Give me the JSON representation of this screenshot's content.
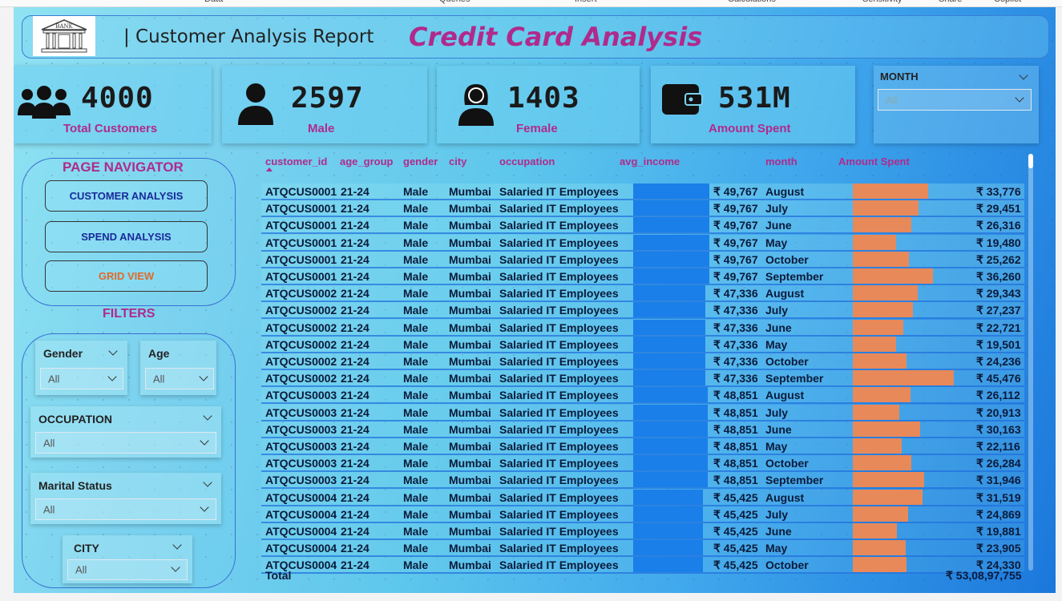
{
  "ribbon": [
    "Data",
    "Queries",
    "Insert",
    "Calculations",
    "Sensitivity",
    "Share",
    "Copilot"
  ],
  "header": {
    "logo_text": "BANK",
    "report_title": "| Customer Analysis Report",
    "main_title": "Credit Card Analysis"
  },
  "kpis": [
    {
      "value": "4000",
      "label": "Total Customers",
      "icon": "users-group-icon"
    },
    {
      "value": "2597",
      "label": "Male",
      "icon": "male-user-icon"
    },
    {
      "value": "1403",
      "label": "Female",
      "icon": "female-user-icon"
    },
    {
      "value": "531M",
      "label": "Amount Spent",
      "icon": "wallet-icon"
    }
  ],
  "month_slicer": {
    "title": "MONTH",
    "value": "All"
  },
  "navigator": {
    "title": "PAGE NAVIGATOR",
    "buttons": [
      {
        "label": "CUSTOMER ANALYSIS",
        "color": "#1a2a9a"
      },
      {
        "label": "SPEND ANALYSIS",
        "color": "#1a2a9a"
      },
      {
        "label": "GRID VIEW",
        "color": "#e06a2a"
      }
    ]
  },
  "filters": {
    "title": "FILTERS",
    "gender": {
      "title": "Gender",
      "value": "All"
    },
    "age": {
      "title": "Age",
      "value": "All"
    },
    "occupation": {
      "title": "OCCUPATION",
      "value": "All"
    },
    "marital": {
      "title": "Marital Status",
      "value": "All"
    },
    "city": {
      "title": "CITY",
      "value": "All"
    }
  },
  "table": {
    "columns": [
      "customer_id",
      "age_group",
      "gender",
      "city",
      "occupation",
      "avg_income",
      "month",
      "Amount Spent"
    ],
    "income_bar_color": "#1a7fe8",
    "spend_bar_color": "#e8895a",
    "rows": [
      {
        "id": "ATQCUS0001",
        "age": "21-24",
        "gender": "Male",
        "city": "Mumbai",
        "occ": "Salaried IT Employees",
        "inc": "₹ 49,767",
        "inc_v": 49767,
        "month": "August",
        "amt": "₹ 33,776",
        "amt_v": 33776
      },
      {
        "id": "ATQCUS0001",
        "age": "21-24",
        "gender": "Male",
        "city": "Mumbai",
        "occ": "Salaried IT Employees",
        "inc": "₹ 49,767",
        "inc_v": 49767,
        "month": "July",
        "amt": "₹ 29,451",
        "amt_v": 29451
      },
      {
        "id": "ATQCUS0001",
        "age": "21-24",
        "gender": "Male",
        "city": "Mumbai",
        "occ": "Salaried IT Employees",
        "inc": "₹ 49,767",
        "inc_v": 49767,
        "month": "June",
        "amt": "₹ 26,316",
        "amt_v": 26316
      },
      {
        "id": "ATQCUS0001",
        "age": "21-24",
        "gender": "Male",
        "city": "Mumbai",
        "occ": "Salaried IT Employees",
        "inc": "₹ 49,767",
        "inc_v": 49767,
        "month": "May",
        "amt": "₹ 19,480",
        "amt_v": 19480
      },
      {
        "id": "ATQCUS0001",
        "age": "21-24",
        "gender": "Male",
        "city": "Mumbai",
        "occ": "Salaried IT Employees",
        "inc": "₹ 49,767",
        "inc_v": 49767,
        "month": "October",
        "amt": "₹ 25,262",
        "amt_v": 25262
      },
      {
        "id": "ATQCUS0001",
        "age": "21-24",
        "gender": "Male",
        "city": "Mumbai",
        "occ": "Salaried IT Employees",
        "inc": "₹ 49,767",
        "inc_v": 49767,
        "month": "September",
        "amt": "₹ 36,260",
        "amt_v": 36260
      },
      {
        "id": "ATQCUS0002",
        "age": "21-24",
        "gender": "Male",
        "city": "Mumbai",
        "occ": "Salaried IT Employees",
        "inc": "₹ 47,336",
        "inc_v": 47336,
        "month": "August",
        "amt": "₹ 29,343",
        "amt_v": 29343
      },
      {
        "id": "ATQCUS0002",
        "age": "21-24",
        "gender": "Male",
        "city": "Mumbai",
        "occ": "Salaried IT Employees",
        "inc": "₹ 47,336",
        "inc_v": 47336,
        "month": "July",
        "amt": "₹ 27,237",
        "amt_v": 27237
      },
      {
        "id": "ATQCUS0002",
        "age": "21-24",
        "gender": "Male",
        "city": "Mumbai",
        "occ": "Salaried IT Employees",
        "inc": "₹ 47,336",
        "inc_v": 47336,
        "month": "June",
        "amt": "₹ 22,721",
        "amt_v": 22721
      },
      {
        "id": "ATQCUS0002",
        "age": "21-24",
        "gender": "Male",
        "city": "Mumbai",
        "occ": "Salaried IT Employees",
        "inc": "₹ 47,336",
        "inc_v": 47336,
        "month": "May",
        "amt": "₹ 19,501",
        "amt_v": 19501
      },
      {
        "id": "ATQCUS0002",
        "age": "21-24",
        "gender": "Male",
        "city": "Mumbai",
        "occ": "Salaried IT Employees",
        "inc": "₹ 47,336",
        "inc_v": 47336,
        "month": "October",
        "amt": "₹ 24,236",
        "amt_v": 24236
      },
      {
        "id": "ATQCUS0002",
        "age": "21-24",
        "gender": "Male",
        "city": "Mumbai",
        "occ": "Salaried IT Employees",
        "inc": "₹ 47,336",
        "inc_v": 47336,
        "month": "September",
        "amt": "₹ 45,476",
        "amt_v": 45476
      },
      {
        "id": "ATQCUS0003",
        "age": "21-24",
        "gender": "Male",
        "city": "Mumbai",
        "occ": "Salaried IT Employees",
        "inc": "₹ 48,851",
        "inc_v": 48851,
        "month": "August",
        "amt": "₹ 26,112",
        "amt_v": 26112
      },
      {
        "id": "ATQCUS0003",
        "age": "21-24",
        "gender": "Male",
        "city": "Mumbai",
        "occ": "Salaried IT Employees",
        "inc": "₹ 48,851",
        "inc_v": 48851,
        "month": "July",
        "amt": "₹ 20,913",
        "amt_v": 20913
      },
      {
        "id": "ATQCUS0003",
        "age": "21-24",
        "gender": "Male",
        "city": "Mumbai",
        "occ": "Salaried IT Employees",
        "inc": "₹ 48,851",
        "inc_v": 48851,
        "month": "June",
        "amt": "₹ 30,163",
        "amt_v": 30163
      },
      {
        "id": "ATQCUS0003",
        "age": "21-24",
        "gender": "Male",
        "city": "Mumbai",
        "occ": "Salaried IT Employees",
        "inc": "₹ 48,851",
        "inc_v": 48851,
        "month": "May",
        "amt": "₹ 22,116",
        "amt_v": 22116
      },
      {
        "id": "ATQCUS0003",
        "age": "21-24",
        "gender": "Male",
        "city": "Mumbai",
        "occ": "Salaried IT Employees",
        "inc": "₹ 48,851",
        "inc_v": 48851,
        "month": "October",
        "amt": "₹ 26,284",
        "amt_v": 26284
      },
      {
        "id": "ATQCUS0003",
        "age": "21-24",
        "gender": "Male",
        "city": "Mumbai",
        "occ": "Salaried IT Employees",
        "inc": "₹ 48,851",
        "inc_v": 48851,
        "month": "September",
        "amt": "₹ 31,946",
        "amt_v": 31946
      },
      {
        "id": "ATQCUS0004",
        "age": "21-24",
        "gender": "Male",
        "city": "Mumbai",
        "occ": "Salaried IT Employees",
        "inc": "₹ 45,425",
        "inc_v": 45425,
        "month": "August",
        "amt": "₹ 31,519",
        "amt_v": 31519
      },
      {
        "id": "ATQCUS0004",
        "age": "21-24",
        "gender": "Male",
        "city": "Mumbai",
        "occ": "Salaried IT Employees",
        "inc": "₹ 45,425",
        "inc_v": 45425,
        "month": "July",
        "amt": "₹ 24,869",
        "amt_v": 24869
      },
      {
        "id": "ATQCUS0004",
        "age": "21-24",
        "gender": "Male",
        "city": "Mumbai",
        "occ": "Salaried IT Employees",
        "inc": "₹ 45,425",
        "inc_v": 45425,
        "month": "June",
        "amt": "₹ 19,881",
        "amt_v": 19881
      },
      {
        "id": "ATQCUS0004",
        "age": "21-24",
        "gender": "Male",
        "city": "Mumbai",
        "occ": "Salaried IT Employees",
        "inc": "₹ 45,425",
        "inc_v": 45425,
        "month": "May",
        "amt": "₹ 23,905",
        "amt_v": 23905
      },
      {
        "id": "ATQCUS0004",
        "age": "21-24",
        "gender": "Male",
        "city": "Mumbai",
        "occ": "Salaried IT Employees",
        "inc": "₹ 45,425",
        "inc_v": 45425,
        "month": "October",
        "amt": "₹ 24,330",
        "amt_v": 24330
      }
    ],
    "total_label": "Total",
    "total_value": "₹ 53,08,97,755"
  }
}
